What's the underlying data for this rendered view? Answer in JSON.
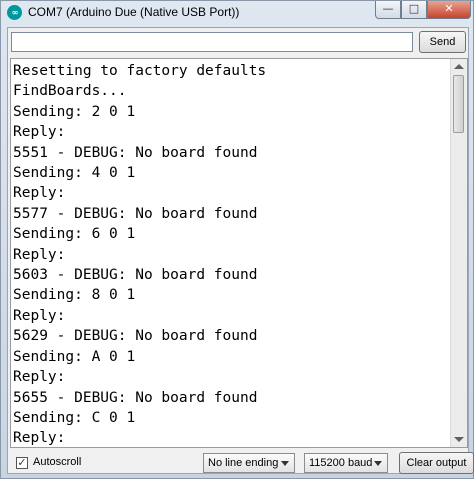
{
  "window": {
    "title": "COM7 (Arduino Due (Native USB Port))",
    "app_icon_label": "∞",
    "minimize_glyph": "—",
    "maximize_glyph": "□",
    "close_glyph": "✕"
  },
  "send": {
    "input_value": "",
    "button_label": "Send"
  },
  "output": {
    "lines": [
      "Resetting to factory defaults",
      "FindBoards...",
      "Sending: 2 0 1",
      "Reply:",
      "5551 - DEBUG: No board found",
      "Sending: 4 0 1",
      "Reply:",
      "5577 - DEBUG: No board found",
      "Sending: 6 0 1",
      "Reply:",
      "5603 - DEBUG: No board found",
      "Sending: 8 0 1",
      "Reply:",
      "5629 - DEBUG: No board found",
      "Sending: A 0 1",
      "Reply:",
      "5655 - DEBUG: No board found",
      "Sending: C 0 1",
      "Reply:"
    ]
  },
  "footer": {
    "autoscroll_label": "Autoscroll",
    "autoscroll_checked": true,
    "check_glyph": "✓",
    "line_ending_selected": "No line ending",
    "baud_selected": "115200 baud",
    "clear_label": "Clear output"
  },
  "icons": {
    "app": "arduino-icon",
    "minimize": "minimize-icon",
    "maximize": "maximize-icon",
    "close": "close-icon",
    "checkbox": "checkmark-icon",
    "dropdown": "chevron-down-icon"
  },
  "colors": {
    "arduino_teal": "#00979c",
    "close_red": "#c7432b"
  }
}
